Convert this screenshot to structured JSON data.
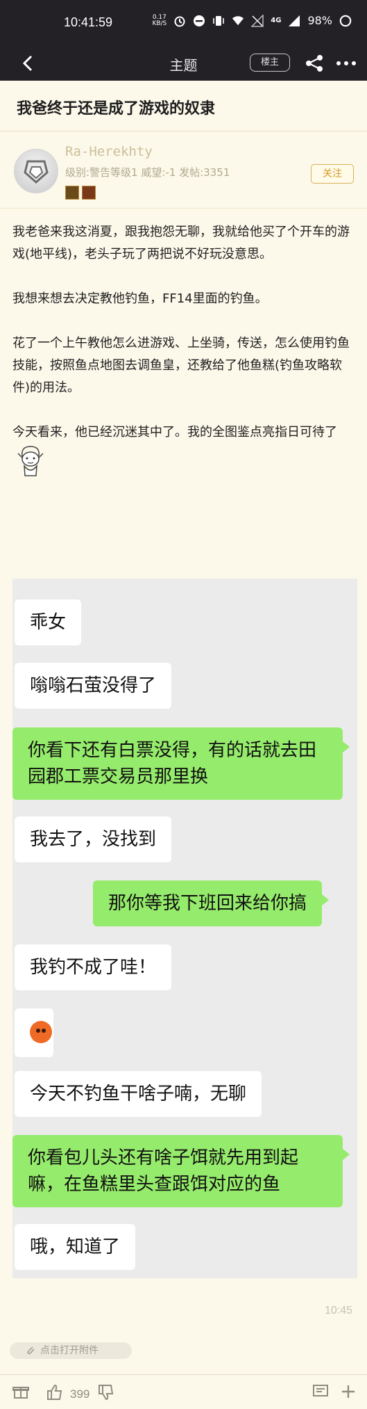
{
  "status_bar": {
    "time": "10:41:59",
    "speed_value": "0.17",
    "speed_unit": "KB/S",
    "network": "4G",
    "battery": "98%"
  },
  "nav": {
    "title": "主题",
    "owner_label": "楼主"
  },
  "post": {
    "title": "我爸终于还是成了游戏的奴隶",
    "author": {
      "name": "Ra-Herekhty",
      "stats": "级别:警告等级1 威望:-1 发帖:3351",
      "follow_label": "关注"
    },
    "paragraphs": [
      "我老爸来我这消夏，跟我抱怨无聊，我就给他买了个开车的游戏(地平线)，老头子玩了两把说不好玩没意思。",
      "我想来想去决定教他钓鱼，FF14里面的钓鱼。",
      "花了一个上午教他怎么进游戏、上坐骑，传送，怎么使用钓鱼技能，按照鱼点地图去调鱼皇，还教给了他鱼糕(钓鱼攻略软件)的用法。",
      "今天看来，他已经沉迷其中了。我的全图鉴点亮指日可待了"
    ]
  },
  "chat": {
    "messages": [
      {
        "text": "乖女"
      },
      {
        "text": "嗡嗡石萤没得了"
      },
      {
        "text": "你看下还有白票没得，有的话就去田园郡工票交易员那里换"
      },
      {
        "text": "我去了，没找到"
      },
      {
        "text": "那你等我下班回来给你搞"
      },
      {
        "text": "我钓不成了哇！"
      },
      {
        "text": "今天不钓鱼干啥子喃，无聊"
      },
      {
        "text": "你看包儿头还有啥子饵就先用到起嘛，在鱼糕里头查跟饵对应的鱼"
      },
      {
        "text": "哦，知道了"
      }
    ]
  },
  "footer": {
    "timestamp": "10:45",
    "attachment_label": "点击打开附件",
    "like_count": "399"
  },
  "colors": {
    "background": "#fcf8ea",
    "top_bar": "#232026",
    "green_bubble": "#95eb6b",
    "author_name": "#ccc09a"
  }
}
